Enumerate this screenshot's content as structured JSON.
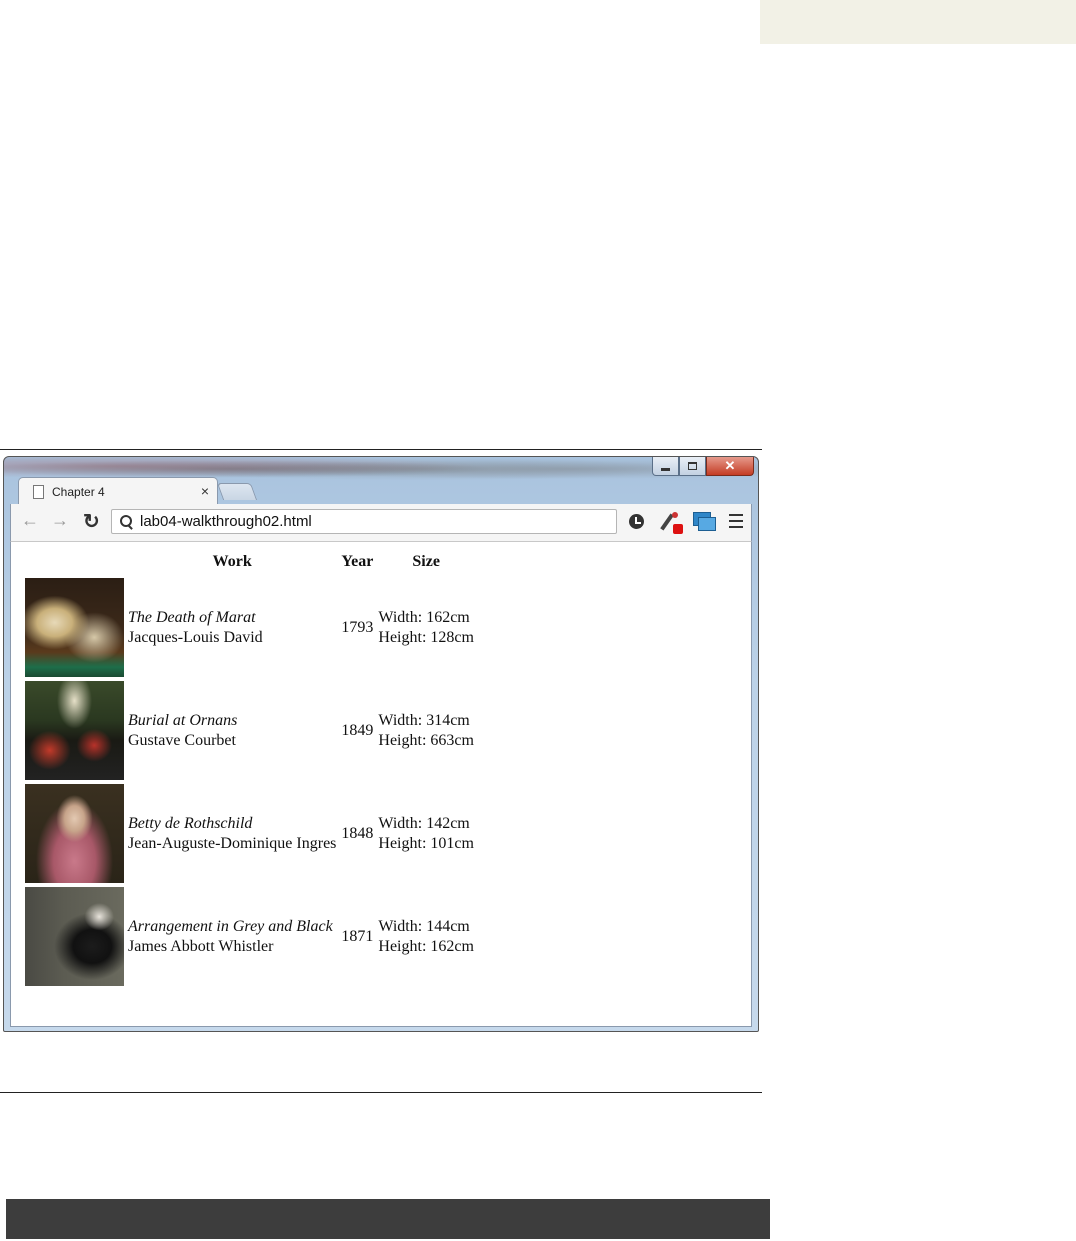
{
  "browser": {
    "tab_title": "Chapter 4",
    "tab_close": "×",
    "close_glyph": "✕",
    "url": "lab04-walkthrough02.html"
  },
  "table": {
    "headers": [
      "Work",
      "Year",
      "Size"
    ],
    "rows": [
      {
        "title": "The Death of Marat",
        "artist": "Jacques-Louis David",
        "year": "1793",
        "width": "Width: 162cm",
        "height": "Height: 128cm"
      },
      {
        "title": "Burial at Ornans",
        "artist": "Gustave Courbet",
        "year": "1849",
        "width": "Width: 314cm",
        "height": "Height: 663cm"
      },
      {
        "title": "Betty de Rothschild",
        "artist": "Jean-Auguste-Dominique Ingres",
        "year": "1848",
        "width": "Width: 142cm",
        "height": "Height: 101cm"
      },
      {
        "title": "Arrangement in Grey and Black",
        "artist": "James Abbott Whistler",
        "year": "1871",
        "width": "Width: 144cm",
        "height": "Height: 162cm"
      }
    ]
  }
}
